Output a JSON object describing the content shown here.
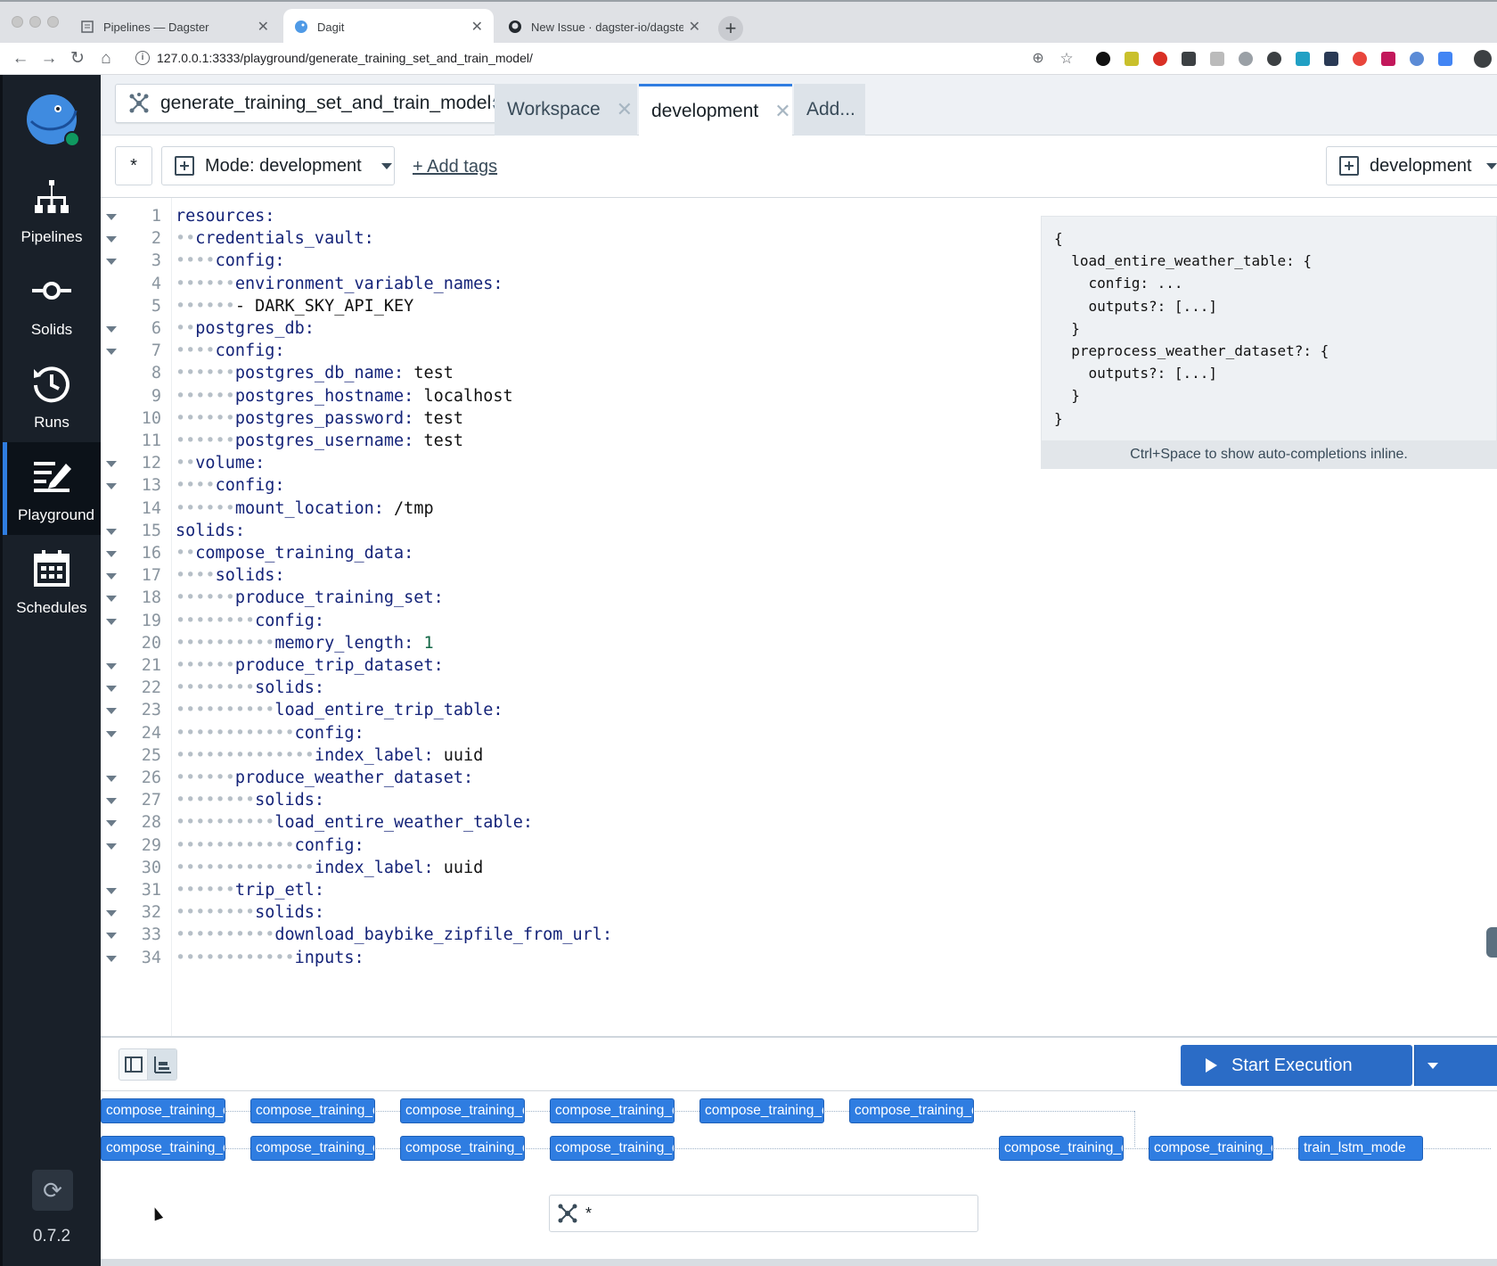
{
  "browser": {
    "tabs": [
      {
        "label": "Pipelines — Dagster",
        "active": false
      },
      {
        "label": "Dagit",
        "active": true
      },
      {
        "label": "New Issue · dagster-io/dagster",
        "active": false
      }
    ],
    "url": "127.0.0.1:3333/playground/generate_training_set_and_train_model/"
  },
  "nav": {
    "items": [
      {
        "label": "Pipelines",
        "icon": "pipelines-icon"
      },
      {
        "label": "Solids",
        "icon": "solids-icon"
      },
      {
        "label": "Runs",
        "icon": "runs-icon"
      },
      {
        "label": "Playground",
        "icon": "playground-icon",
        "active": true
      },
      {
        "label": "Schedules",
        "icon": "schedules-icon"
      }
    ],
    "version": "0.7.2"
  },
  "header": {
    "pipeline": "generate_training_set_and_train_model",
    "session_tabs": [
      {
        "label": "Workspace",
        "active": false
      },
      {
        "label": "development",
        "active": true
      },
      {
        "label": "Add...",
        "active": false
      }
    ]
  },
  "subbar": {
    "solid_subset": "*",
    "mode": "Mode: development",
    "add_tags": "+ Add tags",
    "preset": "development"
  },
  "editor": {
    "lines": [
      {
        "n": 1,
        "d": 0,
        "k": "resources:",
        "v": "",
        "fold": true
      },
      {
        "n": 2,
        "d": 2,
        "k": "credentials_vault:",
        "v": "",
        "fold": true
      },
      {
        "n": 3,
        "d": 4,
        "k": "config:",
        "v": "",
        "fold": true
      },
      {
        "n": 4,
        "d": 6,
        "k": "environment_variable_names:",
        "v": "",
        "fold": false
      },
      {
        "n": 5,
        "d": 6,
        "k": "",
        "v": "- DARK_SKY_API_KEY",
        "fold": false
      },
      {
        "n": 6,
        "d": 2,
        "k": "postgres_db:",
        "v": "",
        "fold": true
      },
      {
        "n": 7,
        "d": 4,
        "k": "config:",
        "v": "",
        "fold": true
      },
      {
        "n": 8,
        "d": 6,
        "k": "postgres_db_name:",
        "v": " test",
        "fold": false
      },
      {
        "n": 9,
        "d": 6,
        "k": "postgres_hostname:",
        "v": " localhost",
        "fold": false
      },
      {
        "n": 10,
        "d": 6,
        "k": "postgres_password:",
        "v": " test",
        "fold": false
      },
      {
        "n": 11,
        "d": 6,
        "k": "postgres_username:",
        "v": " test",
        "fold": false
      },
      {
        "n": 12,
        "d": 2,
        "k": "volume:",
        "v": "",
        "fold": true
      },
      {
        "n": 13,
        "d": 4,
        "k": "config:",
        "v": "",
        "fold": true
      },
      {
        "n": 14,
        "d": 6,
        "k": "mount_location:",
        "v": " /tmp",
        "fold": false
      },
      {
        "n": 15,
        "d": 0,
        "k": "solids:",
        "v": "",
        "fold": true
      },
      {
        "n": 16,
        "d": 2,
        "k": "compose_training_data:",
        "v": "",
        "fold": true
      },
      {
        "n": 17,
        "d": 4,
        "k": "solids:",
        "v": "",
        "fold": true
      },
      {
        "n": 18,
        "d": 6,
        "k": "produce_training_set:",
        "v": "",
        "fold": true
      },
      {
        "n": 19,
        "d": 8,
        "k": "config:",
        "v": "",
        "fold": true
      },
      {
        "n": 20,
        "d": 10,
        "k": "memory_length:",
        "v": "",
        "num": " 1",
        "fold": false
      },
      {
        "n": 21,
        "d": 6,
        "k": "produce_trip_dataset:",
        "v": "",
        "fold": true
      },
      {
        "n": 22,
        "d": 8,
        "k": "solids:",
        "v": "",
        "fold": true
      },
      {
        "n": 23,
        "d": 10,
        "k": "load_entire_trip_table:",
        "v": "",
        "fold": true
      },
      {
        "n": 24,
        "d": 12,
        "k": "config:",
        "v": "",
        "fold": true
      },
      {
        "n": 25,
        "d": 14,
        "k": "index_label:",
        "v": " uuid",
        "fold": false
      },
      {
        "n": 26,
        "d": 6,
        "k": "produce_weather_dataset:",
        "v": "",
        "fold": true
      },
      {
        "n": 27,
        "d": 8,
        "k": "solids:",
        "v": "",
        "fold": true
      },
      {
        "n": 28,
        "d": 10,
        "k": "load_entire_weather_table:",
        "v": "",
        "fold": true
      },
      {
        "n": 29,
        "d": 12,
        "k": "config:",
        "v": "",
        "fold": true
      },
      {
        "n": 30,
        "d": 14,
        "k": "index_label:",
        "v": " uuid",
        "fold": false
      },
      {
        "n": 31,
        "d": 6,
        "k": "trip_etl:",
        "v": "",
        "fold": true
      },
      {
        "n": 32,
        "d": 8,
        "k": "solids:",
        "v": "",
        "fold": true
      },
      {
        "n": 33,
        "d": 10,
        "k": "download_baybike_zipfile_from_url:",
        "v": "",
        "fold": true
      },
      {
        "n": 34,
        "d": 12,
        "k": "inputs:",
        "v": "",
        "fold": true
      }
    ],
    "hint": {
      "lines": [
        "{",
        "  load_entire_weather_table: {",
        "    config: ...",
        "    outputs?: [...]",
        "  }",
        "  preprocess_weather_dataset?: {",
        "    outputs?: [...]",
        "  }",
        "}"
      ],
      "footer": "Ctrl+Space to show auto-completions inline."
    }
  },
  "execution": {
    "start_label": "Start Execution"
  },
  "graph": {
    "row1": [
      "compose_training_d",
      "compose_training_d",
      "compose_training_d",
      "compose_training_d",
      "compose_training_d",
      "compose_training_d"
    ],
    "row2_left": [
      "compose_training_d",
      "compose_training_d",
      "compose_training_d",
      "compose_training_d"
    ],
    "row2_right": [
      "compose_training_d",
      "compose_training_d",
      "train_lstm_mode"
    ],
    "filter": "*"
  }
}
